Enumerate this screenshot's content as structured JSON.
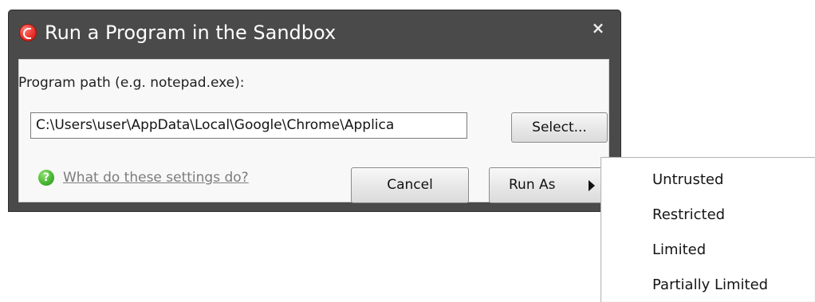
{
  "dialog": {
    "title": "Run a Program in the Sandbox",
    "close": "×"
  },
  "form": {
    "path_label": "Program path (e.g. notepad.exe):",
    "path_value": "C:\\Users\\user\\AppData\\Local\\Google\\Chrome\\Applica",
    "select_label": "Select...",
    "help_text": "What do these settings do?",
    "cancel_label": "Cancel",
    "run_as_label": "Run As"
  },
  "menu": {
    "items": [
      "Untrusted",
      "Restricted",
      "Limited",
      "Partially Limited"
    ]
  },
  "icons": {
    "app": "comodo-app-icon",
    "close": "close-icon",
    "help": "help-icon",
    "submenu": "chevron-right-icon"
  },
  "colors": {
    "title_bar": "#4a4a4a",
    "content_bg": "#f8f8f8",
    "menu_bg": "#ffffff",
    "accent": "#ea2f2a",
    "help": "#49b733"
  }
}
